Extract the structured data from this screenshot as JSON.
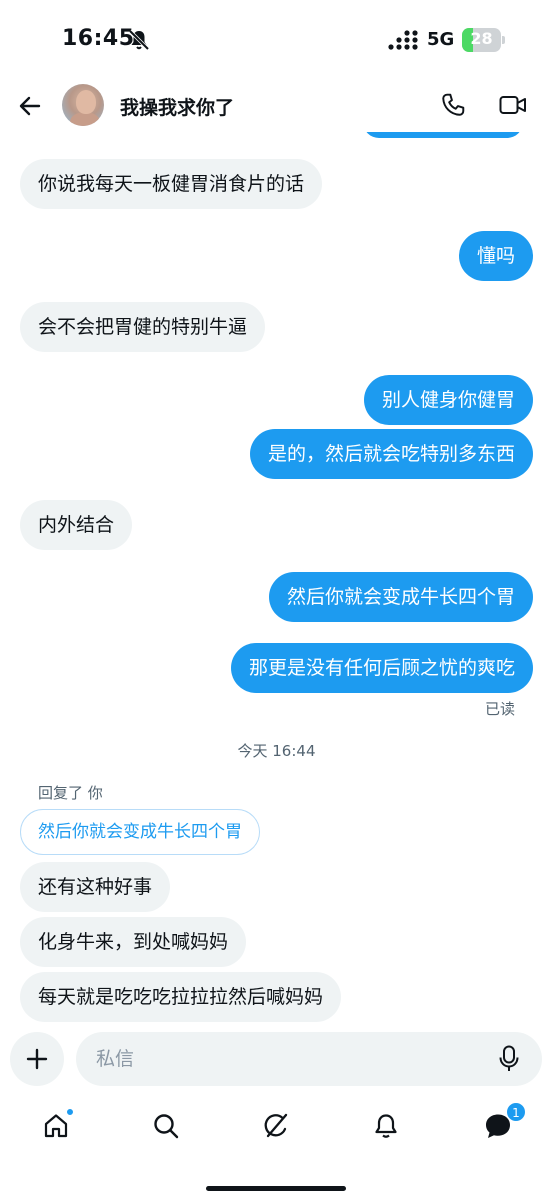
{
  "status_bar": {
    "time": "16:45",
    "network": "5G",
    "battery_level": "28"
  },
  "header": {
    "contact_name": "我操我求你了"
  },
  "messages": [
    {
      "direction": "in",
      "text": "你说我每天一板健胃消食片的话"
    },
    {
      "direction": "out",
      "text": "懂吗"
    },
    {
      "direction": "in",
      "text": "会不会把胃健的特别牛逼"
    },
    {
      "direction": "out",
      "text": "别人健身你健胃"
    },
    {
      "direction": "out",
      "text": "是的，然后就会吃特别多东西"
    },
    {
      "direction": "in",
      "text": "内外结合"
    },
    {
      "direction": "out",
      "text": "然后你就会变成牛长四个胃"
    },
    {
      "direction": "out",
      "text": "那更是没有任何后顾之忧的爽吃"
    },
    {
      "direction": "in",
      "text": "还有这种好事"
    },
    {
      "direction": "in",
      "text": "化身牛来，到处喊妈妈"
    },
    {
      "direction": "in",
      "text": "每天就是吃吃吃拉拉拉然后喊妈妈"
    }
  ],
  "read_receipt": "已读",
  "date_separator": "今天 16:44",
  "reply": {
    "label": "回复了 你",
    "quoted_text": "然后你就会变成牛长四个胃"
  },
  "composer": {
    "placeholder": "私信"
  },
  "nav": {
    "messages_badge": "1"
  },
  "colors": {
    "accent": "#1d9bf0",
    "incoming_bubble": "#eff3f4",
    "secondary_text": "#536471"
  },
  "icons": [
    "bell-muted-icon",
    "signal-icon",
    "battery-icon",
    "back-arrow-icon",
    "phone-icon",
    "video-icon",
    "plus-icon",
    "mic-icon",
    "home-icon",
    "search-icon",
    "grok-icon",
    "bell-icon",
    "messages-icon"
  ]
}
